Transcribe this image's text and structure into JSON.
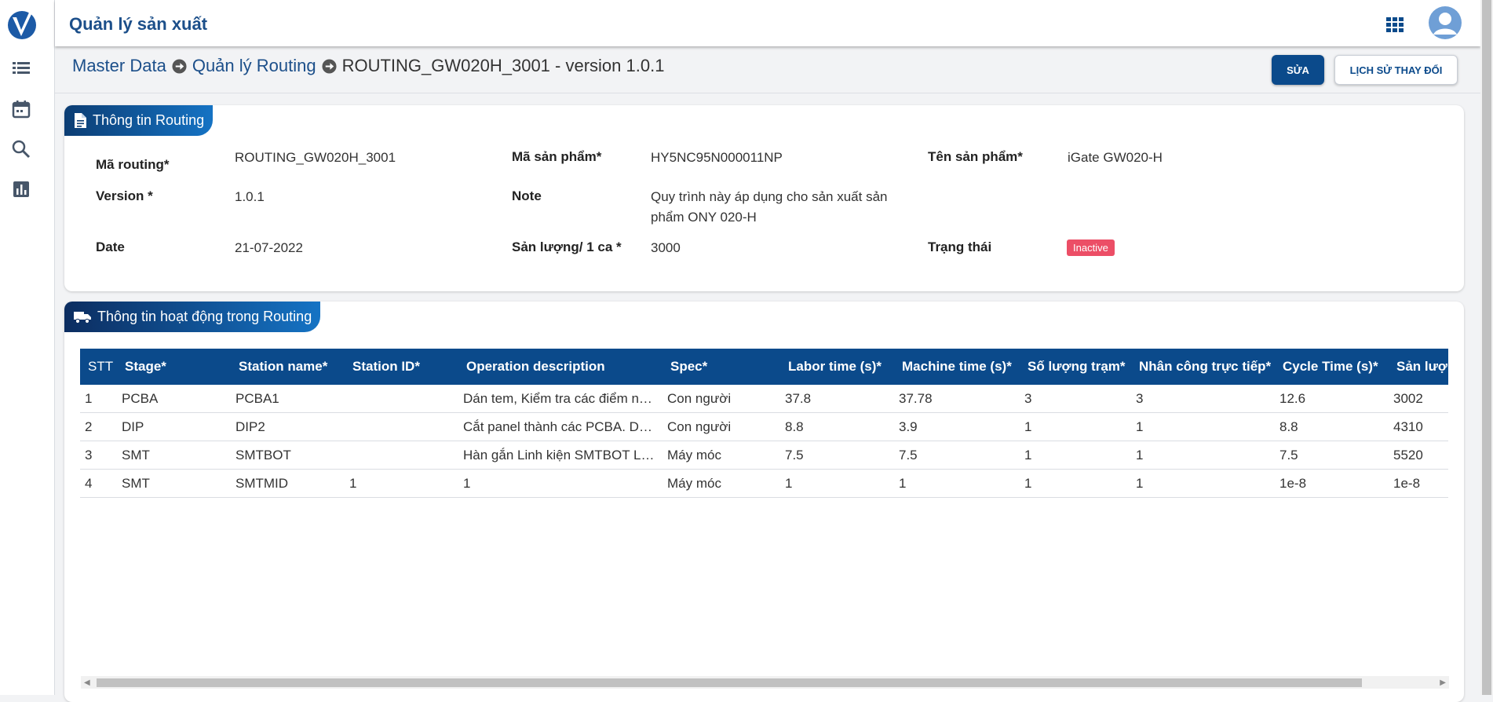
{
  "header": {
    "app_title": "Quản lý sản xuất"
  },
  "sidebar": {
    "icons": [
      "list-icon",
      "calendar-icon",
      "search-icon",
      "chart-icon"
    ]
  },
  "breadcrumb": {
    "items": [
      "Master Data",
      "Quản lý Routing",
      "ROUTING_GW020H_3001 - version 1.0.1"
    ]
  },
  "actions": {
    "edit_label": "SỬA",
    "history_label": "LỊCH SỬ THAY ĐỔI"
  },
  "routing_info": {
    "tab_title": "Thông tin Routing",
    "fields": {
      "routing_code_label": "Mã routing*",
      "routing_code": "ROUTING_GW020H_3001",
      "product_code_label": "Mã sản phẩm*",
      "product_code": "HY5NC95N000011NP",
      "product_name_label": "Tên sản phẩm*",
      "product_name": "iGate GW020-H",
      "version_label": "Version *",
      "version": "1.0.1",
      "note_label": "Note",
      "note": "Quy trình này áp dụng cho sản xuất sản phẩm ONY 020-H",
      "date_label": "Date",
      "date": "21-07-2022",
      "output_label": "Sản lượng/ 1 ca *",
      "output": "3000",
      "status_label": "Trạng thái",
      "status": "Inactive"
    },
    "status_color": "#ec4e66"
  },
  "activities": {
    "tab_title": "Thông tin hoạt động trong Routing",
    "columns": [
      "STT",
      "Stage*",
      "Station name*",
      "Station ID*",
      "Operation description",
      "Spec*",
      "Labor time (s)*",
      "Machine time (s)*",
      "Số lượng trạm*",
      "Nhân công trực tiếp*",
      "Cycle Time (s)*",
      "Sản lượng"
    ],
    "rows": [
      [
        "1",
        "PCBA",
        "PCBA1",
        "",
        "Dán tem, Kiểm tra các điểm ngoại quan",
        "Con người",
        "37.8",
        "37.78",
        "3",
        "3",
        "12.6",
        "3002"
      ],
      [
        "2",
        "DIP",
        "DIP2",
        "",
        "Cắt panel thành các PCBA. Dán tem",
        "Con người",
        "8.8",
        "3.9",
        "1",
        "1",
        "8.8",
        "4310"
      ],
      [
        "3",
        "SMT",
        "SMTBOT",
        "",
        "Hàn gắn Linh kiện SMTBOT LINE",
        "Máy móc",
        "7.5",
        "7.5",
        "1",
        "1",
        "7.5",
        "5520"
      ],
      [
        "4",
        "SMT",
        "SMTMID",
        "1",
        "1",
        "Máy móc",
        "1",
        "1",
        "1",
        "1",
        "1e-8",
        "1e-8"
      ]
    ]
  },
  "colors": {
    "primary": "#0b4a8b",
    "title": "#1c4f8a"
  }
}
